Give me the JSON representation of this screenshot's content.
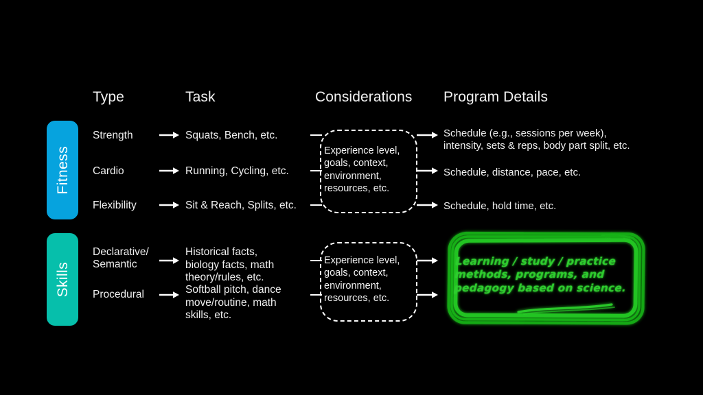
{
  "slide": {
    "background_color": "#000000",
    "text_color": "#f0f0f0"
  },
  "headers": {
    "type": "Type",
    "task": "Task",
    "considerations": "Considerations",
    "program_details": "Program Details"
  },
  "categories": [
    {
      "id": "fitness",
      "label": "Fitness",
      "color": "#06A3DE"
    },
    {
      "id": "skills",
      "label": "Skills",
      "color": "#06BFAB"
    }
  ],
  "rows": {
    "fitness": [
      {
        "type": "Strength",
        "task": "Squats, Bench, etc.",
        "program": "Schedule (e.g., sessions per week),\nintensity, sets & reps, body part split, etc."
      },
      {
        "type": "Cardio",
        "task": "Running, Cycling, etc.",
        "program": "Schedule, distance, pace, etc."
      },
      {
        "type": "Flexibility",
        "task": "Sit & Reach, Splits, etc.",
        "program": "Schedule, hold time, etc."
      }
    ],
    "skills": [
      {
        "type": "Declarative/\nSemantic",
        "task": "Historical facts,\nbiology facts, math\ntheory/rules, etc."
      },
      {
        "type": "Procedural",
        "task": "Softball pitch, dance\nmove/routine, math\nskills, etc."
      }
    ]
  },
  "considerations": {
    "fitness": "Experience level,\ngoals, context,\nenvironment,\nresources, etc.",
    "skills": "Experience level,\ngoals, context,\nenvironment,\nresources, etc."
  },
  "highlight": {
    "text": "Learning / study / practice\nmethods, programs, and\npedagogy based on science.",
    "color": "#2ecc2e",
    "style": "hand-drawn-annotation"
  },
  "icons": {
    "arrow": "arrow-right-icon",
    "stub": "connector-line-icon"
  }
}
